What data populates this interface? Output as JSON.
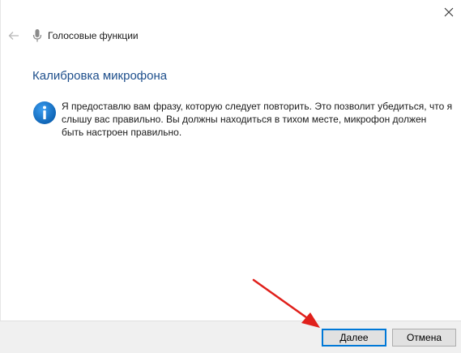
{
  "window": {
    "title": "Голосовые функции",
    "close_glyph": "✕"
  },
  "page": {
    "heading": "Калибровка микрофона",
    "info_text": "Я предоставлю вам фразу, которую следует повторить. Это позволит убедиться, что я\nслышу вас правильно. Вы должны находиться в тихом месте, микрофон должен\nбыть настроен правильно."
  },
  "buttons": {
    "next_label": "Далее",
    "cancel_label": "Отмена"
  },
  "icons": {
    "back": "back-arrow-icon",
    "mic": "microphone-icon",
    "info": "info-icon",
    "close": "close-icon"
  },
  "colors": {
    "accent": "#0078d7",
    "heading": "#1e4f8c",
    "info_icon": "#0f6cbd",
    "annotation_arrow": "#e0201b"
  }
}
